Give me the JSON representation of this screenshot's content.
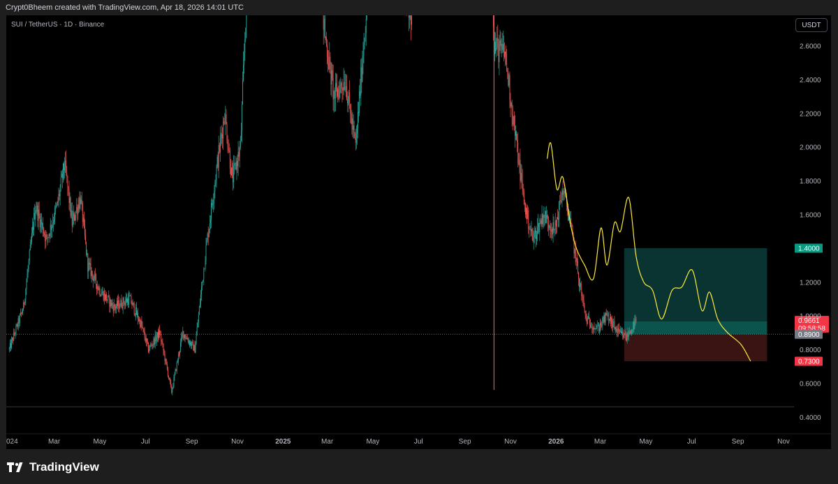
{
  "header": {
    "attribution": "Crypt0Bheem created with TradingView.com, Apr 18, 2026 14:01 UTC"
  },
  "symbol": {
    "label": "SUI / TetherUS · 1D · Binance"
  },
  "currency": {
    "label": "USDT"
  },
  "footer": {
    "brand": "TradingView"
  },
  "colors": {
    "up": "#26a69a",
    "down": "#ef5350",
    "projection": "#ffeb3b",
    "profit_zone": "#0a3d3a",
    "loss_zone": "#3d1414",
    "background": "#000000"
  },
  "chart_data": {
    "type": "candlestick",
    "ylim": [
      0.3,
      2.78
    ],
    "y_ticks": [
      {
        "value": 2.6,
        "label": "2.6000"
      },
      {
        "value": 2.4,
        "label": "2.4000"
      },
      {
        "value": 2.2,
        "label": "2.2000"
      },
      {
        "value": 2.0,
        "label": "2.0000"
      },
      {
        "value": 1.8,
        "label": "1.8000"
      },
      {
        "value": 1.6,
        "label": "1.6000"
      },
      {
        "value": 1.2,
        "label": "1.2000"
      },
      {
        "value": 0.8,
        "label": "0.8000"
      },
      {
        "value": 0.6,
        "label": "0.6000"
      },
      {
        "value": 0.4,
        "label": "0.4000"
      }
    ],
    "x_ticks": [
      {
        "date": "2024-01-01",
        "label": "024"
      },
      {
        "date": "2024-03-01",
        "label": "Mar"
      },
      {
        "date": "2024-05-01",
        "label": "May"
      },
      {
        "date": "2024-07-01",
        "label": "Jul"
      },
      {
        "date": "2024-09-01",
        "label": "Sep"
      },
      {
        "date": "2024-11-01",
        "label": "Nov"
      },
      {
        "date": "2025-01-01",
        "label": "2025",
        "bold": true
      },
      {
        "date": "2025-03-01",
        "label": "Mar"
      },
      {
        "date": "2025-05-01",
        "label": "May"
      },
      {
        "date": "2025-07-01",
        "label": "Jul"
      },
      {
        "date": "2025-09-01",
        "label": "Sep"
      },
      {
        "date": "2025-11-01",
        "label": "Nov"
      },
      {
        "date": "2026-01-01",
        "label": "2026",
        "bold": true
      },
      {
        "date": "2026-03-01",
        "label": "Mar"
      },
      {
        "date": "2026-05-01",
        "label": "May"
      },
      {
        "date": "2026-07-01",
        "label": "Jul"
      },
      {
        "date": "2026-09-01",
        "label": "Sep"
      },
      {
        "date": "2026-11-01",
        "label": "Nov"
      }
    ],
    "x_range": [
      "2023-12-28",
      "2026-11-15"
    ],
    "price_keypoints": [
      {
        "date": "2024-01-01",
        "price": 0.8
      },
      {
        "date": "2024-01-20",
        "price": 1.05
      },
      {
        "date": "2024-02-05",
        "price": 1.65
      },
      {
        "date": "2024-02-20",
        "price": 1.45
      },
      {
        "date": "2024-03-05",
        "price": 1.65
      },
      {
        "date": "2024-03-15",
        "price": 1.9
      },
      {
        "date": "2024-03-25",
        "price": 1.55
      },
      {
        "date": "2024-04-05",
        "price": 1.7
      },
      {
        "date": "2024-04-15",
        "price": 1.3
      },
      {
        "date": "2024-05-01",
        "price": 1.15
      },
      {
        "date": "2024-05-20",
        "price": 1.05
      },
      {
        "date": "2024-06-10",
        "price": 1.1
      },
      {
        "date": "2024-06-25",
        "price": 0.95
      },
      {
        "date": "2024-07-05",
        "price": 0.8
      },
      {
        "date": "2024-07-20",
        "price": 0.9
      },
      {
        "date": "2024-08-05",
        "price": 0.55
      },
      {
        "date": "2024-08-20",
        "price": 0.9
      },
      {
        "date": "2024-09-05",
        "price": 0.8
      },
      {
        "date": "2024-09-20",
        "price": 1.4
      },
      {
        "date": "2024-10-05",
        "price": 1.9
      },
      {
        "date": "2024-10-15",
        "price": 2.2
      },
      {
        "date": "2024-10-25",
        "price": 1.8
      },
      {
        "date": "2024-11-05",
        "price": 2.0
      },
      {
        "date": "2024-11-15",
        "price": 3.1
      },
      {
        "date": "2024-12-05",
        "price": 4.2
      },
      {
        "date": "2024-12-25",
        "price": 4.4
      },
      {
        "date": "2025-01-05",
        "price": 4.9
      },
      {
        "date": "2025-01-25",
        "price": 4.1
      },
      {
        "date": "2025-02-10",
        "price": 3.4
      },
      {
        "date": "2025-02-25",
        "price": 2.7
      },
      {
        "date": "2025-03-10",
        "price": 2.3
      },
      {
        "date": "2025-03-25",
        "price": 2.4
      },
      {
        "date": "2025-04-08",
        "price": 2.0
      },
      {
        "date": "2025-04-22",
        "price": 2.8
      },
      {
        "date": "2025-05-10",
        "price": 3.8
      },
      {
        "date": "2025-06-01",
        "price": 3.2
      },
      {
        "date": "2025-06-20",
        "price": 2.75
      },
      {
        "date": "2025-07-10",
        "price": 3.5
      },
      {
        "date": "2025-07-25",
        "price": 4.1
      },
      {
        "date": "2025-08-15",
        "price": 3.6
      },
      {
        "date": "2025-09-05",
        "price": 3.4
      },
      {
        "date": "2025-09-20",
        "price": 3.8
      },
      {
        "date": "2025-10-05",
        "price": 3.5
      },
      {
        "date": "2025-10-10",
        "price": 2.6
      },
      {
        "date": "2025-10-25",
        "price": 2.55
      },
      {
        "date": "2025-11-05",
        "price": 2.15
      },
      {
        "date": "2025-11-20",
        "price": 1.65
      },
      {
        "date": "2025-12-01",
        "price": 1.45
      },
      {
        "date": "2025-12-15",
        "price": 1.6
      },
      {
        "date": "2025-12-30",
        "price": 1.5
      },
      {
        "date": "2026-01-10",
        "price": 1.75
      },
      {
        "date": "2026-01-20",
        "price": 1.55
      },
      {
        "date": "2026-02-01",
        "price": 1.2
      },
      {
        "date": "2026-02-10",
        "price": 0.98
      },
      {
        "date": "2026-02-25",
        "price": 0.92
      },
      {
        "date": "2026-03-10",
        "price": 1.0
      },
      {
        "date": "2026-03-25",
        "price": 0.9
      },
      {
        "date": "2026-04-05",
        "price": 0.87
      },
      {
        "date": "2026-04-18",
        "price": 0.9661
      }
    ],
    "spikes": [
      {
        "date": "2025-10-10",
        "low": 0.56,
        "high": 2.78,
        "color": "down"
      }
    ],
    "projection_path": [
      {
        "date": "2025-12-20",
        "price": 1.93
      },
      {
        "date": "2025-12-25",
        "price": 2.02
      },
      {
        "date": "2026-01-02",
        "price": 1.75
      },
      {
        "date": "2026-01-10",
        "price": 1.82
      },
      {
        "date": "2026-01-20",
        "price": 1.55
      },
      {
        "date": "2026-01-28",
        "price": 1.4
      },
      {
        "date": "2026-02-08",
        "price": 1.3
      },
      {
        "date": "2026-02-20",
        "price": 1.22
      },
      {
        "date": "2026-03-02",
        "price": 1.52
      },
      {
        "date": "2026-03-10",
        "price": 1.3
      },
      {
        "date": "2026-03-20",
        "price": 1.55
      },
      {
        "date": "2026-03-28",
        "price": 1.5
      },
      {
        "date": "2026-04-08",
        "price": 1.7
      },
      {
        "date": "2026-04-18",
        "price": 1.35
      },
      {
        "date": "2026-04-28",
        "price": 1.2
      },
      {
        "date": "2026-05-10",
        "price": 1.15
      },
      {
        "date": "2026-05-22",
        "price": 0.98
      },
      {
        "date": "2026-06-05",
        "price": 1.15
      },
      {
        "date": "2026-06-18",
        "price": 1.17
      },
      {
        "date": "2026-07-02",
        "price": 1.27
      },
      {
        "date": "2026-07-15",
        "price": 1.03
      },
      {
        "date": "2026-07-25",
        "price": 1.14
      },
      {
        "date": "2026-08-05",
        "price": 0.98
      },
      {
        "date": "2026-08-18",
        "price": 0.9
      },
      {
        "date": "2026-09-05",
        "price": 0.83
      },
      {
        "date": "2026-09-18",
        "price": 0.73
      }
    ],
    "position": {
      "start_date": "2026-04-02",
      "end_date": "2026-10-10",
      "target": 1.4,
      "entry": 0.89,
      "stop": 0.73
    },
    "horizontal_lines": [
      {
        "price": 0.89,
        "style": "dotted"
      },
      {
        "price": 0.46,
        "style": "solid"
      }
    ],
    "price_labels": [
      {
        "price": 1.4,
        "label": "1.4000",
        "color": "#089981"
      },
      {
        "price": 0.9661,
        "label": "0.9661",
        "sub": "09:58:58",
        "color": "#f23645"
      },
      {
        "price": 0.89,
        "label": "0.8900",
        "color": "#787b86"
      },
      {
        "price": 0.73,
        "label": "0.7300",
        "color": "#f23645"
      },
      {
        "price": 1.0,
        "label": "1.0000",
        "color": "none"
      }
    ]
  }
}
